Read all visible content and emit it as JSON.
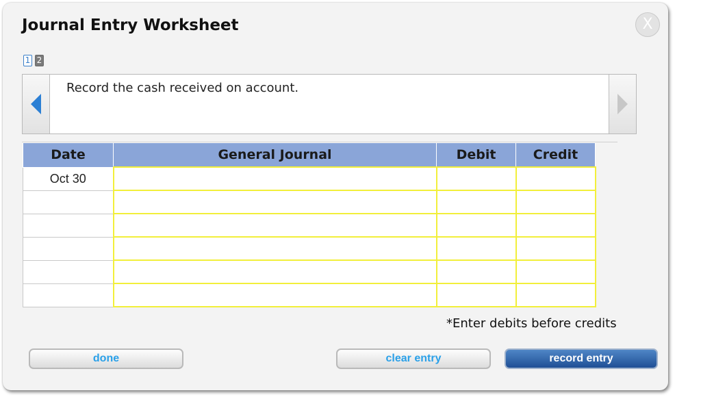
{
  "dialog": {
    "title": "Journal Entry Worksheet",
    "close_label": "X"
  },
  "pager": {
    "pages": [
      "1",
      "2"
    ],
    "active": 0
  },
  "prompt": {
    "text": "Record the cash received on account."
  },
  "table": {
    "headers": {
      "date": "Date",
      "general_journal": "General Journal",
      "debit": "Debit",
      "credit": "Credit"
    },
    "rows": [
      {
        "date": "Oct 30",
        "account": "",
        "debit": "",
        "credit": ""
      },
      {
        "date": "",
        "account": "",
        "debit": "",
        "credit": ""
      },
      {
        "date": "",
        "account": "",
        "debit": "",
        "credit": ""
      },
      {
        "date": "",
        "account": "",
        "debit": "",
        "credit": ""
      },
      {
        "date": "",
        "account": "",
        "debit": "",
        "credit": ""
      },
      {
        "date": "",
        "account": "",
        "debit": "",
        "credit": ""
      }
    ]
  },
  "note": "*Enter debits before credits",
  "buttons": {
    "done": "done",
    "clear_entry": "clear entry",
    "record_entry": "record entry"
  },
  "icons": {
    "prev": "triangle-left-icon",
    "next": "triangle-right-icon",
    "close": "close-icon"
  },
  "colors": {
    "header_bg": "#8aa5d8",
    "input_border": "#f2ef3a",
    "link_blue": "#2aa0e8",
    "primary_button": "#1f4f95"
  }
}
